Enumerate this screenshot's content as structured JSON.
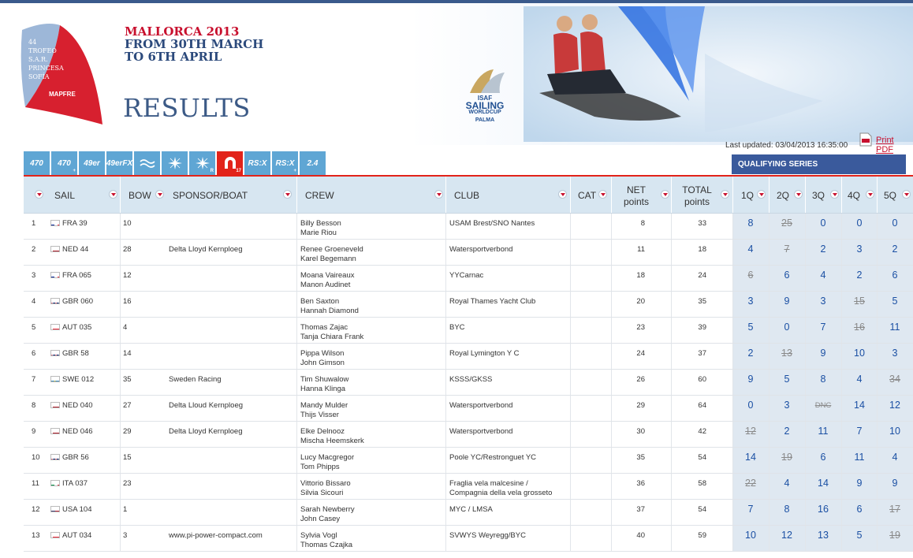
{
  "header": {
    "logo_text": [
      "44",
      "TROFEO",
      "S.A.R.",
      "PRINCESA",
      "SOFÍA",
      "MAPFRE"
    ],
    "event_line1": "MALLORCA 2013",
    "event_line2": "FROM 30TH MARCH",
    "event_line3": "TO 6TH APRIL",
    "title": "RESULTS",
    "isaf": {
      "line1": "ISAF",
      "line2": "SAILING",
      "line3": "WORLDCUP",
      "line4": "PALMA"
    }
  },
  "updated": "Last updated: 03/04/2013 16:35:00",
  "print_pdf": "Print PDF",
  "class_tabs": [
    {
      "label": "470",
      "sub": "",
      "kind": "text",
      "active": false
    },
    {
      "label": "470",
      "sub": "+",
      "kind": "text",
      "active": false
    },
    {
      "label": "49er",
      "sub": "",
      "kind": "text",
      "active": false
    },
    {
      "label": "49erFX",
      "sub": "",
      "kind": "text",
      "active": false
    },
    {
      "label": "",
      "sub": "",
      "kind": "wave",
      "active": false
    },
    {
      "label": "",
      "sub": "",
      "kind": "star",
      "active": false
    },
    {
      "label": "",
      "sub": "R",
      "kind": "star",
      "active": false
    },
    {
      "label": "",
      "sub": "17",
      "kind": "magnet",
      "active": true
    },
    {
      "label": "RS:X",
      "sub": "",
      "kind": "text",
      "active": false
    },
    {
      "label": "RS:X",
      "sub": "+",
      "kind": "text",
      "active": false
    },
    {
      "label": "2.4",
      "sub": "",
      "kind": "text",
      "active": false
    }
  ],
  "qualifying_label": "QUALIFYING SERIES",
  "columns": {
    "sail": "SAIL",
    "bow": "BOW",
    "sponsor": "SPONSOR/BOAT",
    "crew": "CREW",
    "club": "CLUB",
    "cat": "CAT",
    "net_1": "NET",
    "net_2": "points",
    "total_1": "TOTAL",
    "total_2": "points",
    "races": [
      "1Q",
      "2Q",
      "3Q",
      "4Q",
      "5Q"
    ]
  },
  "colors": {
    "accent": "#e2231a",
    "header_blue": "#3a5a9c",
    "race_text": "#1a4fa3"
  },
  "rows": [
    {
      "pos": "1",
      "flag": "fra",
      "sail": "FRA 39",
      "bow": "10",
      "sponsor": "",
      "crew": [
        "Billy Besson",
        "Marie Riou"
      ],
      "club": [
        "USAM Brest/SNO Nantes"
      ],
      "net": "8",
      "total": "33",
      "races": [
        {
          "v": "8"
        },
        {
          "v": "25",
          "d": true
        },
        {
          "v": "0"
        },
        {
          "v": "0"
        },
        {
          "v": "0"
        }
      ]
    },
    {
      "pos": "2",
      "flag": "ned",
      "sail": "NED 44",
      "bow": "28",
      "sponsor": "Delta Lloyd Kernploeg",
      "crew": [
        "Renee Groeneveld",
        "Karel Begemann"
      ],
      "club": [
        "Watersportverbond"
      ],
      "net": "11",
      "total": "18",
      "races": [
        {
          "v": "4"
        },
        {
          "v": "7",
          "d": true
        },
        {
          "v": "2"
        },
        {
          "v": "3"
        },
        {
          "v": "2"
        }
      ]
    },
    {
      "pos": "3",
      "flag": "fra",
      "sail": "FRA 065",
      "bow": "12",
      "sponsor": "",
      "crew": [
        "Moana Vaireaux",
        "Manon Audinet"
      ],
      "club": [
        "YYCarnac"
      ],
      "net": "18",
      "total": "24",
      "races": [
        {
          "v": "6",
          "d": true
        },
        {
          "v": "6"
        },
        {
          "v": "4"
        },
        {
          "v": "2"
        },
        {
          "v": "6"
        }
      ]
    },
    {
      "pos": "4",
      "flag": "gbr",
      "sail": "GBR 060",
      "bow": "16",
      "sponsor": "",
      "crew": [
        "Ben Saxton",
        "Hannah Diamond"
      ],
      "club": [
        "Royal Thames Yacht Club"
      ],
      "net": "20",
      "total": "35",
      "races": [
        {
          "v": "3"
        },
        {
          "v": "9"
        },
        {
          "v": "3"
        },
        {
          "v": "15",
          "d": true
        },
        {
          "v": "5"
        }
      ]
    },
    {
      "pos": "5",
      "flag": "aut",
      "sail": "AUT 035",
      "bow": "4",
      "sponsor": "",
      "crew": [
        "Thomas Zajac",
        "Tanja Chiara Frank"
      ],
      "club": [
        "BYC"
      ],
      "net": "23",
      "total": "39",
      "races": [
        {
          "v": "5"
        },
        {
          "v": "0"
        },
        {
          "v": "7"
        },
        {
          "v": "16",
          "d": true
        },
        {
          "v": "11"
        }
      ]
    },
    {
      "pos": "6",
      "flag": "gbr",
      "sail": "GBR 58",
      "bow": "14",
      "sponsor": "",
      "crew": [
        "Pippa Wilson",
        "John Gimson"
      ],
      "club": [
        "Royal Lymington Y C"
      ],
      "net": "24",
      "total": "37",
      "races": [
        {
          "v": "2"
        },
        {
          "v": "13",
          "d": true
        },
        {
          "v": "9"
        },
        {
          "v": "10"
        },
        {
          "v": "3"
        }
      ]
    },
    {
      "pos": "7",
      "flag": "swe",
      "sail": "SWE 012",
      "bow": "35",
      "sponsor": "Sweden Racing",
      "crew": [
        "Tim Shuwalow",
        "Hanna Klinga"
      ],
      "club": [
        "KSSS/GKSS"
      ],
      "net": "26",
      "total": "60",
      "races": [
        {
          "v": "9"
        },
        {
          "v": "5"
        },
        {
          "v": "8"
        },
        {
          "v": "4"
        },
        {
          "v": "34",
          "d": true
        }
      ]
    },
    {
      "pos": "8",
      "flag": "ned",
      "sail": "NED 040",
      "bow": "27",
      "sponsor": "Delta Lloud Kernploeg",
      "crew": [
        "Mandy Mulder",
        "Thijs Visser"
      ],
      "club": [
        "Watersportverbond"
      ],
      "net": "29",
      "total": "64",
      "races": [
        {
          "v": "0"
        },
        {
          "v": "3"
        },
        {
          "v": "DNC",
          "d": true,
          "code": true
        },
        {
          "v": "14"
        },
        {
          "v": "12"
        }
      ]
    },
    {
      "pos": "9",
      "flag": "ned",
      "sail": "NED 046",
      "bow": "29",
      "sponsor": "Delta Lloyd Kernploeg",
      "crew": [
        "Elke Delnooz",
        "Mischa Heemskerk"
      ],
      "club": [
        "Watersportverbond"
      ],
      "net": "30",
      "total": "42",
      "races": [
        {
          "v": "12",
          "d": true
        },
        {
          "v": "2"
        },
        {
          "v": "11"
        },
        {
          "v": "7"
        },
        {
          "v": "10"
        }
      ]
    },
    {
      "pos": "10",
      "flag": "gbr",
      "sail": "GBR 56",
      "bow": "15",
      "sponsor": "",
      "crew": [
        "Lucy Macgregor",
        "Tom Phipps"
      ],
      "club": [
        "Poole YC/Restronguet YC"
      ],
      "net": "35",
      "total": "54",
      "races": [
        {
          "v": "14"
        },
        {
          "v": "19",
          "d": true
        },
        {
          "v": "6"
        },
        {
          "v": "11"
        },
        {
          "v": "4"
        }
      ]
    },
    {
      "pos": "11",
      "flag": "ita",
      "sail": "ITA 037",
      "bow": "23",
      "sponsor": "",
      "crew": [
        "Vittorio Bissaro",
        "Silvia Sicouri"
      ],
      "club": [
        "Fraglia vela malcesine /",
        "Compagnia della vela grosseto"
      ],
      "net": "36",
      "total": "58",
      "races": [
        {
          "v": "22",
          "d": true
        },
        {
          "v": "4"
        },
        {
          "v": "14"
        },
        {
          "v": "9"
        },
        {
          "v": "9"
        }
      ]
    },
    {
      "pos": "12",
      "flag": "usa",
      "sail": "USA 104",
      "bow": "1",
      "sponsor": "",
      "crew": [
        "Sarah Newberry",
        "John Casey"
      ],
      "club": [
        "MYC / LMSA"
      ],
      "net": "37",
      "total": "54",
      "races": [
        {
          "v": "7"
        },
        {
          "v": "8"
        },
        {
          "v": "16"
        },
        {
          "v": "6"
        },
        {
          "v": "17",
          "d": true
        }
      ]
    },
    {
      "pos": "13",
      "flag": "aut",
      "sail": "AUT 034",
      "bow": "3",
      "sponsor": "www.pi-power-compact.com",
      "crew": [
        "Sylvia Vogl",
        "Thomas Czajka"
      ],
      "club": [
        "SVWYS Weyregg/BYC"
      ],
      "net": "40",
      "total": "59",
      "races": [
        {
          "v": "10"
        },
        {
          "v": "12"
        },
        {
          "v": "13"
        },
        {
          "v": "5"
        },
        {
          "v": "19",
          "d": true
        }
      ]
    }
  ]
}
